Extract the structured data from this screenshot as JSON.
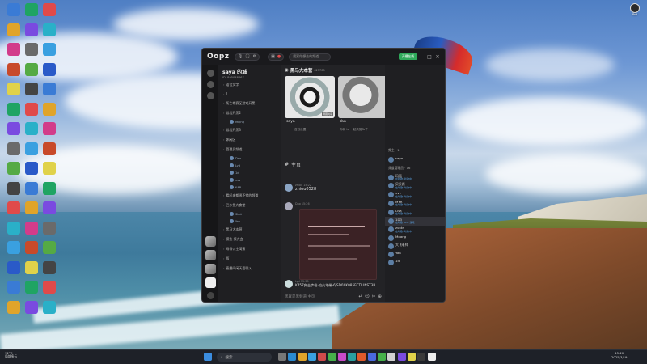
{
  "desktop": {
    "icons_col1": [
      "",
      "",
      "",
      "",
      "",
      "",
      "",
      "",
      "",
      "",
      "",
      "",
      "",
      "",
      "",
      "",
      "",
      ""
    ],
    "top_right_label": "Pad"
  },
  "window": {
    "logo": "Oopz",
    "search_placeholder": "搜索你想去的频道",
    "green_button": "开播在线",
    "minimize": "—",
    "maximize": "□",
    "close": "✕"
  },
  "server": {
    "name": "saya 的城",
    "id": "ID: 895048867",
    "channels": [
      {
        "label": "语音文字"
      },
      {
        "label": "1"
      },
      {
        "label": "死亡拳赛区游戏开黑"
      },
      {
        "label": "游戏开黑2"
      },
      {
        "label": "游戏开黑3"
      },
      {
        "label": "休闲区"
      },
      {
        "label": "管理员频道"
      },
      {
        "label": "看起来都很不错的频道"
      },
      {
        "label": "巴沙鱼大食堂"
      },
      {
        "label": "黑马大本营"
      },
      {
        "label": "摸鱼·摸大会"
      },
      {
        "label": "母母公主闺蜜"
      },
      {
        "label": "两"
      },
      {
        "label": "直播间闲天语聊入"
      }
    ],
    "sub_members": [
      "Mqing",
      "Dao",
      "Lyd",
      "1d",
      "vvv",
      "KAR",
      "Skut",
      "Yan"
    ]
  },
  "room": {
    "title": "黑马大本营",
    "id_small": "025705",
    "cams": [
      {
        "name": "saya",
        "sub": "音效设置",
        "badge": "屏幕共享"
      },
      {
        "name": "Yan",
        "sub": "你和 ta 一起共赏Ta了~~"
      }
    ],
    "section": "主页",
    "messages": [
      {
        "user": "zhiou",
        "time": "15:22",
        "text": "zhiou0528"
      },
      {
        "user": "Dao",
        "time": "15:26",
        "text": ""
      },
      {
        "user": "Lyd",
        "time": "15:30",
        "text": "K457突击步枪·焰火地带-6JSD0XK085FCTIUNST3B"
      }
    ],
    "input_placeholder": "黑就是黑频道 主页"
  },
  "right_panel": {
    "owner_header": "频主 · 1",
    "owner": "saya",
    "admins_header": "频道管理员 · 16",
    "members": [
      {
        "name": "玛丽",
        "status": "在听歌: 听歌中"
      },
      {
        "name": "贝贝酱",
        "status": "在听歌: 听歌中"
      },
      {
        "name": "vvv",
        "status": "在听歌: 听歌中"
      },
      {
        "name": "MYR",
        "status": "在听歌: 听歌中"
      },
      {
        "name": "Lisa",
        "status": "在听歌: 听歌中"
      },
      {
        "name": "1D3",
        "status": "在听歌 ODE 游戏"
      },
      {
        "name": "zvoks",
        "status": "在听歌: 听歌中"
      },
      {
        "name": "Mqang",
        "status": ""
      },
      {
        "name": "大飞老师",
        "status": ""
      },
      {
        "name": "Yan",
        "status": ""
      },
      {
        "name": "1d",
        "status": ""
      }
    ]
  },
  "taskbar": {
    "weather_temp": "12°C",
    "weather_desc": "局部多云",
    "search_placeholder": "搜索",
    "time": "15:20",
    "date": "2025/3/19"
  }
}
